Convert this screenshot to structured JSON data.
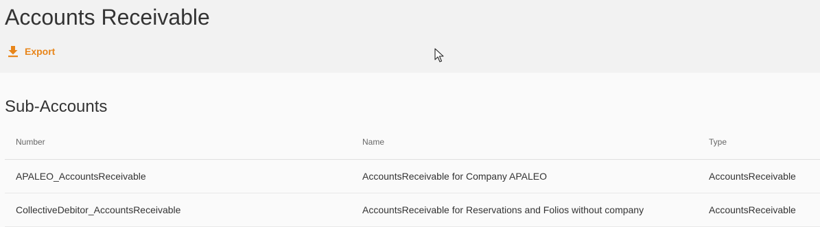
{
  "header": {
    "title": "Accounts Receivable",
    "export_label": "Export",
    "accent_color": "#e8851a"
  },
  "section": {
    "title": "Sub-Accounts"
  },
  "table": {
    "columns": [
      "Number",
      "Name",
      "Type"
    ],
    "rows": [
      {
        "number": "APALEO_AccountsReceivable",
        "name": "AccountsReceivable for Company APALEO",
        "type": "AccountsReceivable"
      },
      {
        "number": "CollectiveDebitor_AccountsReceivable",
        "name": "AccountsReceivable for Reservations and Folios without company",
        "type": "AccountsReceivable"
      }
    ]
  },
  "icons": {
    "export": "download-icon",
    "pointer": "mouse-cursor-icon"
  }
}
